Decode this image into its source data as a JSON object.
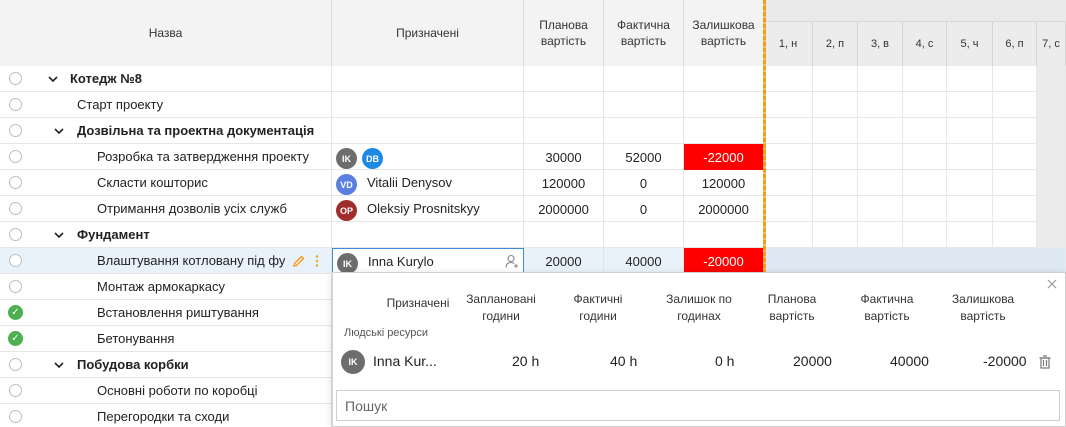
{
  "columns": {
    "name": "Назва",
    "assigned": "Призначені",
    "planned_cost": "Планова вартість",
    "actual_cost": "Фактична вартість",
    "remaining_cost": "Залишкова вартість"
  },
  "gantt_days": [
    "1, н",
    "2, п",
    "3, в",
    "4, с",
    "5, ч",
    "6, п",
    "7, с"
  ],
  "rows": [
    {
      "name": "Котедж №8",
      "level": 0,
      "group": true,
      "expanded": true,
      "done": false
    },
    {
      "name": "Старт проекту",
      "level": 1,
      "group": false,
      "done": false
    },
    {
      "name": "Дозвільна та проектна документація",
      "level": 1,
      "group": true,
      "expanded": true,
      "done": false
    },
    {
      "name": "Розробка та затвердження проекту",
      "level": 2,
      "group": false,
      "done": false,
      "assignees": [
        {
          "initials": "IK",
          "color": "#6d6d6d"
        },
        {
          "initials": "DB",
          "color": "#1e88e5"
        }
      ],
      "planned": "30000",
      "actual": "52000",
      "remaining": "-22000",
      "negative": true
    },
    {
      "name": "Скласти кошторис",
      "level": 2,
      "group": false,
      "done": false,
      "assignees": [
        {
          "initials": "VD",
          "color": "#5b7fe0",
          "name": "Vitalii Denysov"
        }
      ],
      "planned": "120000",
      "actual": "0",
      "remaining": "120000"
    },
    {
      "name": "Отримання дозволів усіх служб",
      "level": 2,
      "group": false,
      "done": false,
      "assignees": [
        {
          "initials": "OP",
          "color": "#a02c2c",
          "name": "Oleksiy Prosnitskyy"
        }
      ],
      "planned": "2000000",
      "actual": "0",
      "remaining": "2000000"
    },
    {
      "name": "Фундамент",
      "level": 1,
      "group": true,
      "expanded": true,
      "done": false
    },
    {
      "name": "Влаштування котловану під фу",
      "level": 2,
      "group": false,
      "done": false,
      "selected": true,
      "assignees": [
        {
          "initials": "IK",
          "color": "#6d6d6d",
          "name": "Inna Kurylo"
        }
      ],
      "planned": "20000",
      "actual": "40000",
      "remaining": "-20000",
      "negative": true
    },
    {
      "name": "Монтаж армокаркасу",
      "level": 2,
      "group": false,
      "done": false
    },
    {
      "name": "Встановлення риштування",
      "level": 2,
      "group": false,
      "done": true
    },
    {
      "name": "Бетонування",
      "level": 2,
      "group": false,
      "done": true
    },
    {
      "name": "Побудова корбки",
      "level": 1,
      "group": true,
      "expanded": true,
      "done": false
    },
    {
      "name": "Основні роботи по коробці",
      "level": 2,
      "group": false,
      "done": false
    },
    {
      "name": "Перегородки та сходи",
      "level": 2,
      "group": false,
      "done": false
    }
  ],
  "popup": {
    "headers": {
      "assigned": "Призначені",
      "planned_hours": "Заплановані години",
      "actual_hours": "Фактичні години",
      "remaining_hours": "Залишок по годинах",
      "planned_cost": "Планова вартість",
      "actual_cost": "Фактична вартість",
      "remaining_cost": "Залишкова вартість"
    },
    "section_label": "Людські ресурси",
    "resource": {
      "initials": "IK",
      "name": "Inna Kur...",
      "planned_hours": "20 h",
      "actual_hours": "40 h",
      "remaining_hours": "0 h",
      "planned_cost": "20000",
      "actual_cost": "40000",
      "remaining_cost": "-20000"
    },
    "search_placeholder": "Пошук"
  },
  "colors": {
    "negative": "#ff0000",
    "divider": "#f59c1a",
    "done": "#4caf50",
    "selected_row": "#e9f2fb"
  }
}
